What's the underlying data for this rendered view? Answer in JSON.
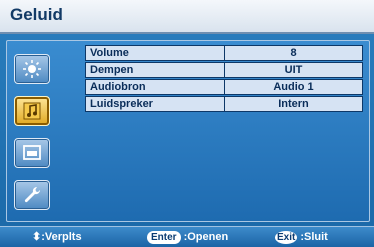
{
  "window": {
    "title": "Geluid"
  },
  "sidebar": {
    "icons": [
      {
        "name": "brightness-icon"
      },
      {
        "name": "audio-icon",
        "active": true
      },
      {
        "name": "display-icon"
      },
      {
        "name": "settings-wrench-icon"
      }
    ]
  },
  "settings": {
    "rows": [
      {
        "label": "Volume",
        "value": "8"
      },
      {
        "label": "Dempen",
        "value": "UIT"
      },
      {
        "label": "Audiobron",
        "value": "Audio 1"
      },
      {
        "label": "Luidspreker",
        "value": "Intern"
      }
    ]
  },
  "footer": {
    "move_label": ":Verplts",
    "enter_key": "Enter",
    "enter_label": ":Openen",
    "exit_key": "Exit",
    "exit_label": ":Sluit"
  },
  "colors": {
    "background": "#1d6fae",
    "title_text": "#123a66",
    "active_icon": "#e0a820",
    "cell_bg": "#d6e3f3"
  }
}
